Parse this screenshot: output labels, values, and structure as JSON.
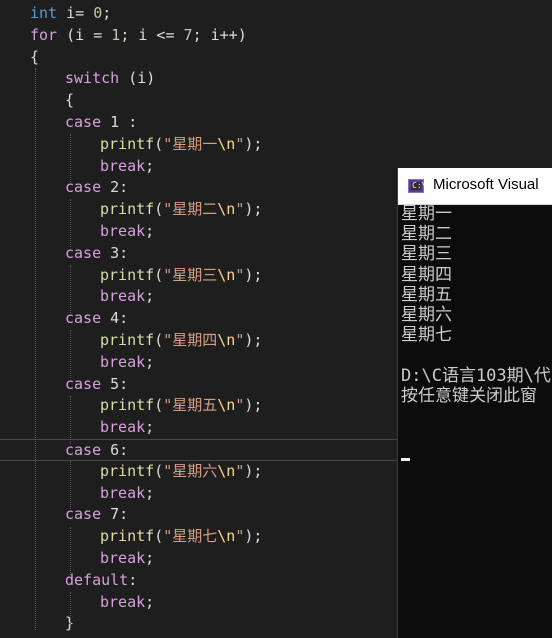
{
  "code": [
    [
      {
        "t": "int",
        "c": "kw"
      },
      {
        "t": " i= ",
        "c": "plain"
      },
      {
        "t": "0",
        "c": "num"
      },
      {
        "t": ";",
        "c": "plain"
      }
    ],
    [
      {
        "t": "for",
        "c": "ctl"
      },
      {
        "t": " (i = ",
        "c": "plain"
      },
      {
        "t": "1",
        "c": "num"
      },
      {
        "t": "; i <= ",
        "c": "plain"
      },
      {
        "t": "7",
        "c": "num"
      },
      {
        "t": "; i++)",
        "c": "plain"
      }
    ],
    [
      {
        "t": "{",
        "c": "plain"
      }
    ],
    [
      {
        "t": "switch",
        "c": "ctl"
      },
      {
        "t": " (i)",
        "c": "plain"
      }
    ],
    [
      {
        "t": "{",
        "c": "plain"
      }
    ],
    [
      {
        "t": "case",
        "c": "ctl"
      },
      {
        "t": " 1 :",
        "c": "plain"
      }
    ],
    [
      {
        "t": "printf",
        "c": "fn"
      },
      {
        "t": "(",
        "c": "plain"
      },
      {
        "t": "\"星期一",
        "c": "str"
      },
      {
        "t": "\\n",
        "c": "esc"
      },
      {
        "t": "\"",
        "c": "str"
      },
      {
        "t": ");",
        "c": "plain"
      }
    ],
    [
      {
        "t": "break",
        "c": "ctl"
      },
      {
        "t": ";",
        "c": "plain"
      }
    ],
    [
      {
        "t": "case",
        "c": "ctl"
      },
      {
        "t": " 2:",
        "c": "plain"
      }
    ],
    [
      {
        "t": "printf",
        "c": "fn"
      },
      {
        "t": "(",
        "c": "plain"
      },
      {
        "t": "\"星期二",
        "c": "str"
      },
      {
        "t": "\\n",
        "c": "esc"
      },
      {
        "t": "\"",
        "c": "str"
      },
      {
        "t": ");",
        "c": "plain"
      }
    ],
    [
      {
        "t": "break",
        "c": "ctl"
      },
      {
        "t": ";",
        "c": "plain"
      }
    ],
    [
      {
        "t": "case",
        "c": "ctl"
      },
      {
        "t": " 3:",
        "c": "plain"
      }
    ],
    [
      {
        "t": "printf",
        "c": "fn"
      },
      {
        "t": "(",
        "c": "plain"
      },
      {
        "t": "\"星期三",
        "c": "str"
      },
      {
        "t": "\\n",
        "c": "esc"
      },
      {
        "t": "\"",
        "c": "str"
      },
      {
        "t": ");",
        "c": "plain"
      }
    ],
    [
      {
        "t": "break",
        "c": "ctl"
      },
      {
        "t": ";",
        "c": "plain"
      }
    ],
    [
      {
        "t": "case",
        "c": "ctl"
      },
      {
        "t": " 4:",
        "c": "plain"
      }
    ],
    [
      {
        "t": "printf",
        "c": "fn"
      },
      {
        "t": "(",
        "c": "plain"
      },
      {
        "t": "\"星期四",
        "c": "str"
      },
      {
        "t": "\\n",
        "c": "esc"
      },
      {
        "t": "\"",
        "c": "str"
      },
      {
        "t": ");",
        "c": "plain"
      }
    ],
    [
      {
        "t": "break",
        "c": "ctl"
      },
      {
        "t": ";",
        "c": "plain"
      }
    ],
    [
      {
        "t": "case",
        "c": "ctl"
      },
      {
        "t": " 5:",
        "c": "plain"
      }
    ],
    [
      {
        "t": "printf",
        "c": "fn"
      },
      {
        "t": "(",
        "c": "plain"
      },
      {
        "t": "\"星期五",
        "c": "str"
      },
      {
        "t": "\\n",
        "c": "esc"
      },
      {
        "t": "\"",
        "c": "str"
      },
      {
        "t": ");",
        "c": "plain"
      }
    ],
    [
      {
        "t": "break",
        "c": "ctl"
      },
      {
        "t": ";",
        "c": "plain"
      }
    ],
    [
      {
        "t": "case",
        "c": "ctl"
      },
      {
        "t": " 6:",
        "c": "plain"
      }
    ],
    [
      {
        "t": "printf",
        "c": "fn"
      },
      {
        "t": "(",
        "c": "plain"
      },
      {
        "t": "\"星期六",
        "c": "str"
      },
      {
        "t": "\\n",
        "c": "esc"
      },
      {
        "t": "\"",
        "c": "str"
      },
      {
        "t": ");",
        "c": "plain"
      }
    ],
    [
      {
        "t": "break",
        "c": "ctl"
      },
      {
        "t": ";",
        "c": "plain"
      }
    ],
    [
      {
        "t": "case",
        "c": "ctl"
      },
      {
        "t": " 7:",
        "c": "plain"
      }
    ],
    [
      {
        "t": "printf",
        "c": "fn"
      },
      {
        "t": "(",
        "c": "plain"
      },
      {
        "t": "\"星期七",
        "c": "str"
      },
      {
        "t": "\\n",
        "c": "esc"
      },
      {
        "t": "\"",
        "c": "str"
      },
      {
        "t": ");",
        "c": "plain"
      }
    ],
    [
      {
        "t": "break",
        "c": "ctl"
      },
      {
        "t": ";",
        "c": "plain"
      }
    ],
    [
      {
        "t": "default",
        "c": "ctl"
      },
      {
        "t": ":",
        "c": "plain"
      }
    ],
    [
      {
        "t": "break",
        "c": "ctl"
      },
      {
        "t": ";",
        "c": "plain"
      }
    ],
    [
      {
        "t": "}",
        "c": "plain"
      }
    ]
  ],
  "console": {
    "title": "Microsoft Visual",
    "icon": "console-app-icon",
    "output": [
      "星期一",
      "星期二",
      "星期三",
      "星期四",
      "星期五",
      "星期六",
      "星期七",
      "",
      "D:\\C语言103期\\代",
      "按任意键关闭此窗"
    ]
  }
}
